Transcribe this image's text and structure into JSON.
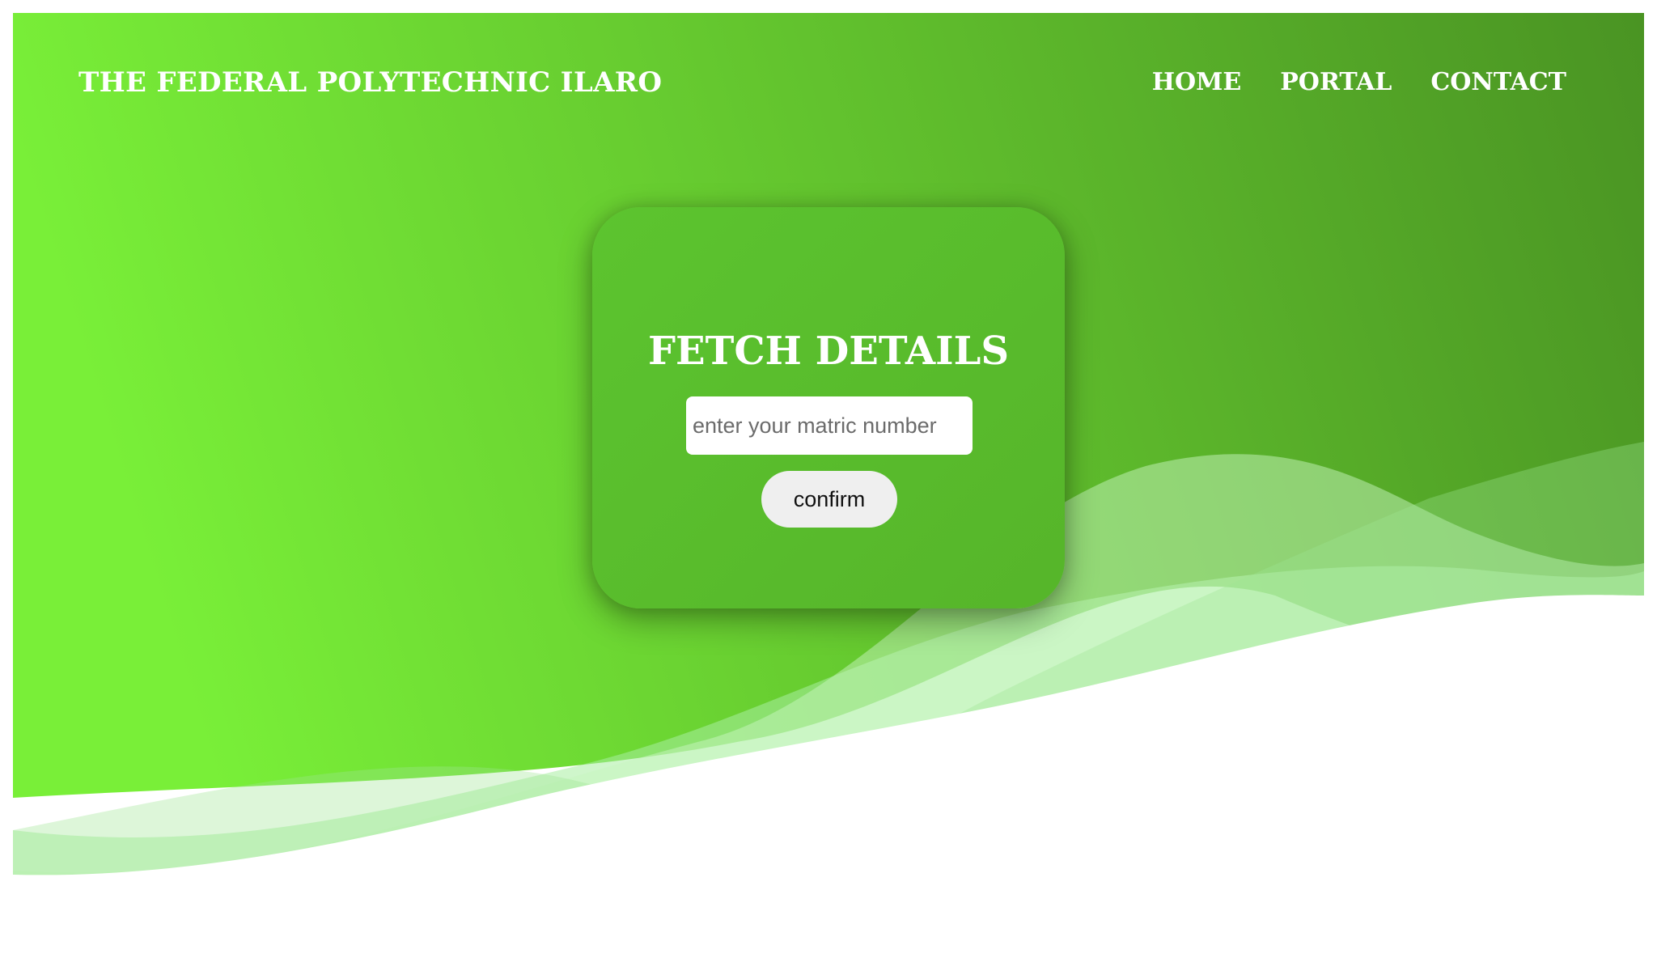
{
  "navbar": {
    "brand": "THE FEDERAL POLYTECHNIC ILARO",
    "links": [
      {
        "label": "HOME"
      },
      {
        "label": "PORTAL"
      },
      {
        "label": "CONTACT"
      }
    ]
  },
  "form": {
    "title": "FETCH DETAILS",
    "input_value": "",
    "input_placeholder": "enter your matric number",
    "confirm_label": "confirm"
  },
  "colors": {
    "gradient_start": "#79ef38",
    "gradient_end": "#4a9423",
    "card_bg": "#5cc42f",
    "wave_light": "#b8f3b0",
    "button_bg": "#efefef",
    "text_white": "#ffffff"
  }
}
